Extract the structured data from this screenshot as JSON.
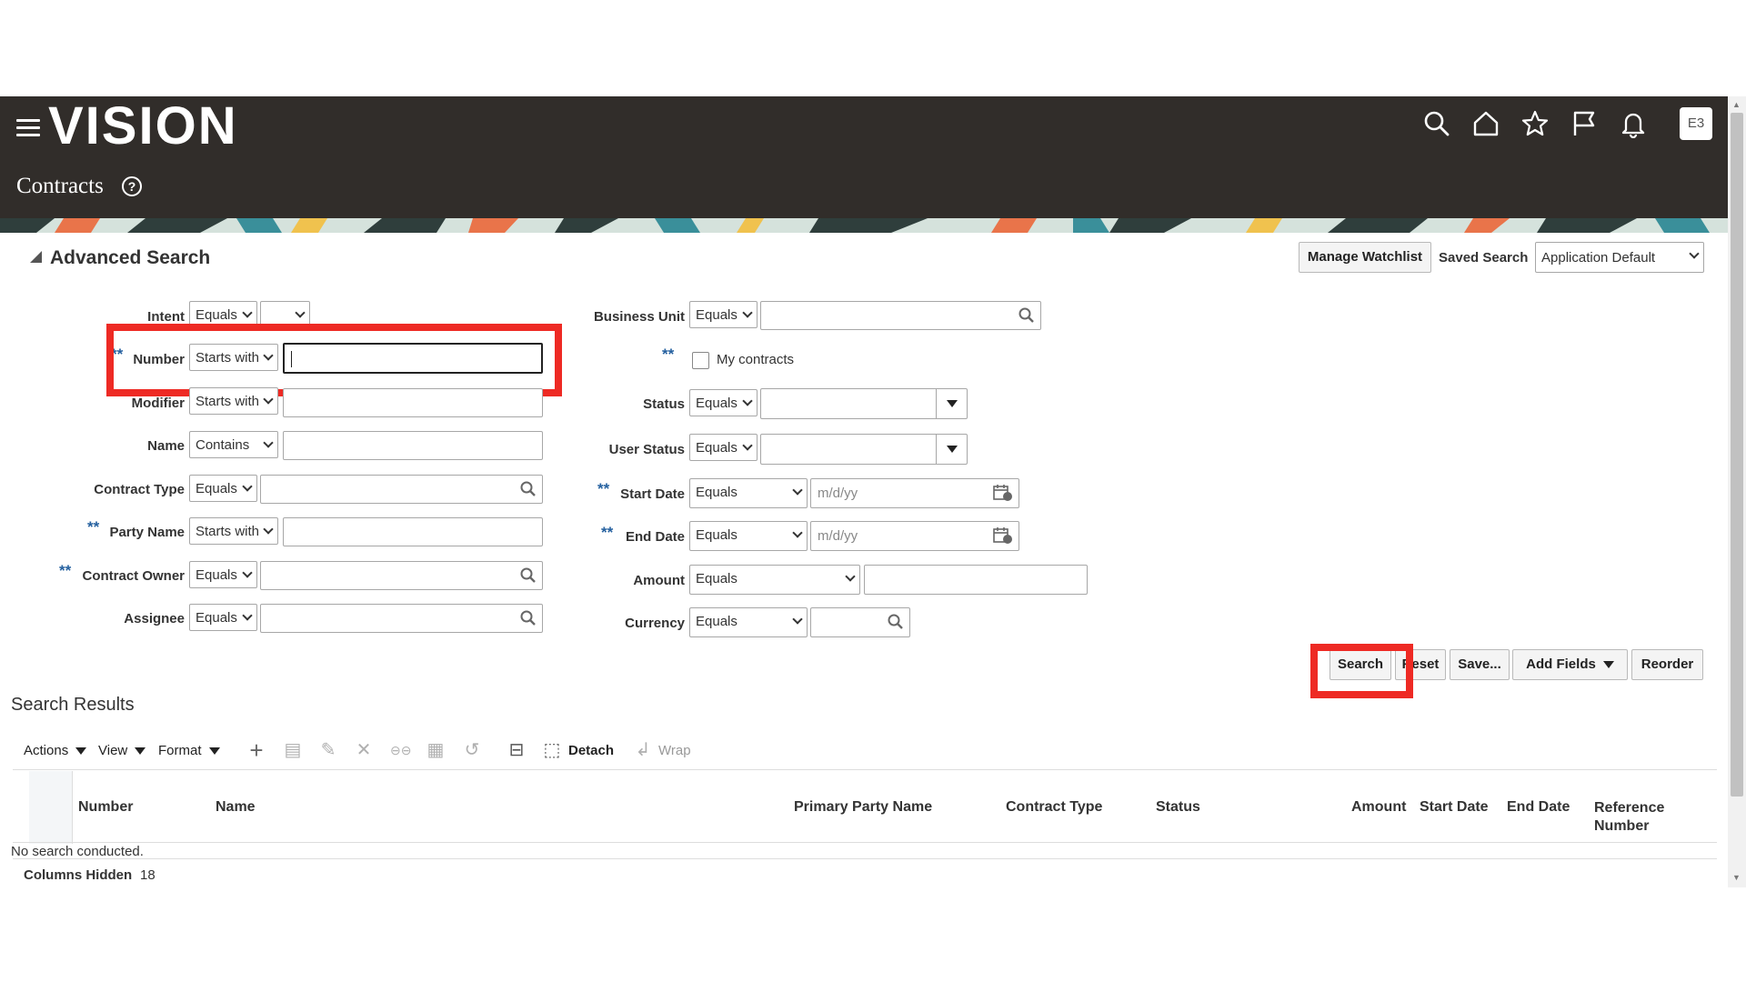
{
  "header": {
    "brand": "VISION",
    "page_title": "Contracts",
    "help_icon": "?",
    "avatar": "E3",
    "icons": [
      "search-icon",
      "home-icon",
      "star-icon",
      "flag-icon",
      "bell-icon"
    ]
  },
  "advanced_search": {
    "title": "Advanced Search",
    "manage_watchlist": "Manage Watchlist",
    "saved_search_label": "Saved Search",
    "saved_search_value": "Application Default"
  },
  "left_fields": [
    {
      "label": "Intent",
      "operator": "Equals",
      "required": false
    },
    {
      "label": "Number",
      "operator": "Starts with",
      "required": true
    },
    {
      "label": "Modifier",
      "operator": "Starts with",
      "required": false
    },
    {
      "label": "Name",
      "operator": "Contains",
      "required": false
    },
    {
      "label": "Contract Type",
      "operator": "Equals",
      "required": false
    },
    {
      "label": "Party Name",
      "operator": "Starts with",
      "required": true
    },
    {
      "label": "Contract Owner",
      "operator": "Equals",
      "required": true
    },
    {
      "label": "Assignee",
      "operator": "Equals",
      "required": false
    }
  ],
  "right_fields": {
    "business_unit": {
      "label": "Business Unit",
      "operator": "Equals"
    },
    "my_contracts": {
      "label": "My contracts",
      "required_marker": "**"
    },
    "status": {
      "label": "Status",
      "operator": "Equals"
    },
    "user_status": {
      "label": "User Status",
      "operator": "Equals"
    },
    "start_date": {
      "label": "Start Date",
      "operator": "Equals",
      "placeholder": "m/d/yy",
      "required_marker": "**"
    },
    "end_date": {
      "label": "End Date",
      "operator": "Equals",
      "placeholder": "m/d/yy",
      "required_marker": "**"
    },
    "amount": {
      "label": "Amount",
      "operator": "Equals"
    },
    "currency": {
      "label": "Currency",
      "operator": "Equals"
    }
  },
  "required_marker": "**",
  "buttons": {
    "search": "Search",
    "reset": "Reset",
    "save": "Save...",
    "add_fields": "Add Fields",
    "reorder": "Reorder"
  },
  "results": {
    "title": "Search Results",
    "toolbar": {
      "actions": "Actions",
      "view": "View",
      "format": "Format",
      "detach": "Detach",
      "wrap": "Wrap"
    },
    "columns": [
      "Number",
      "Name",
      "Primary Party Name",
      "Contract Type",
      "Status",
      "Amount",
      "Start Date",
      "End Date",
      "Reference Number"
    ],
    "empty_message": "No search conducted.",
    "columns_hidden_label": "Columns Hidden",
    "columns_hidden_count": "18"
  },
  "colors": {
    "header_bg": "#312d2a",
    "highlight": "#ee2a24",
    "required": "#24609f"
  }
}
